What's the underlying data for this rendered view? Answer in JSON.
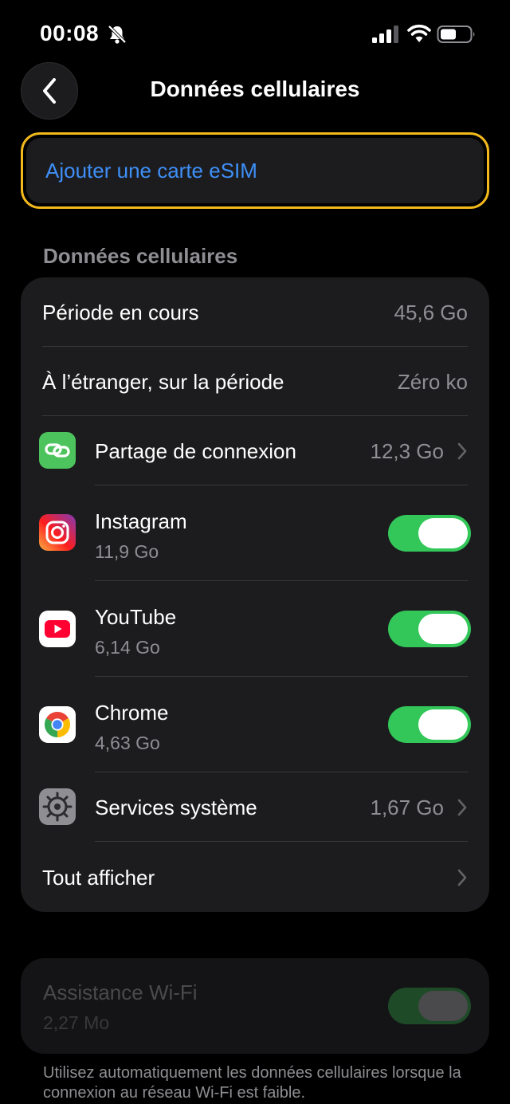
{
  "status_bar": {
    "time": "00:08",
    "icons": [
      "bell-slash-icon",
      "signal-icon",
      "wifi-icon",
      "battery-icon"
    ]
  },
  "nav": {
    "title": "Données cellulaires",
    "back_icon": "chevron-left-icon"
  },
  "esim": {
    "label": "Ajouter une carte eSIM",
    "highlight_color": "#f2b81c",
    "link_color": "#3e8ff7"
  },
  "section": {
    "header": "Données cellulaires"
  },
  "rows": {
    "current_period": {
      "label": "Période en cours",
      "value": "45,6 Go"
    },
    "roaming": {
      "label": "À l’étranger, sur la période",
      "value": "Zéro ko"
    },
    "hotspot": {
      "label": "Partage de connexion",
      "value": "12,3 Go",
      "icon": "hotspot-link-icon"
    },
    "instagram": {
      "label": "Instagram",
      "usage": "11,9 Go",
      "enabled": true,
      "icon": "instagram-icon"
    },
    "youtube": {
      "label": "YouTube",
      "usage": "6,14 Go",
      "enabled": true,
      "icon": "youtube-icon"
    },
    "chrome": {
      "label": "Chrome",
      "usage": "4,63 Go",
      "enabled": true,
      "icon": "chrome-icon"
    },
    "system_services": {
      "label": "Services système",
      "value": "1,67 Go",
      "icon": "gear-icon"
    },
    "show_all": {
      "label": "Tout afficher"
    }
  },
  "wifi_assist": {
    "label": "Assistance Wi-Fi",
    "usage": "2,27 Mo",
    "enabled": true,
    "disabled_state": true
  },
  "footer": {
    "text": "Utilisez automatiquement les données cellulaires lorsque la connexion au réseau Wi-Fi est faible."
  },
  "colors": {
    "toggle_on": "#33c759",
    "background": "#000000",
    "group_background": "#1c1c1e",
    "secondary_text": "#8e8e93"
  }
}
